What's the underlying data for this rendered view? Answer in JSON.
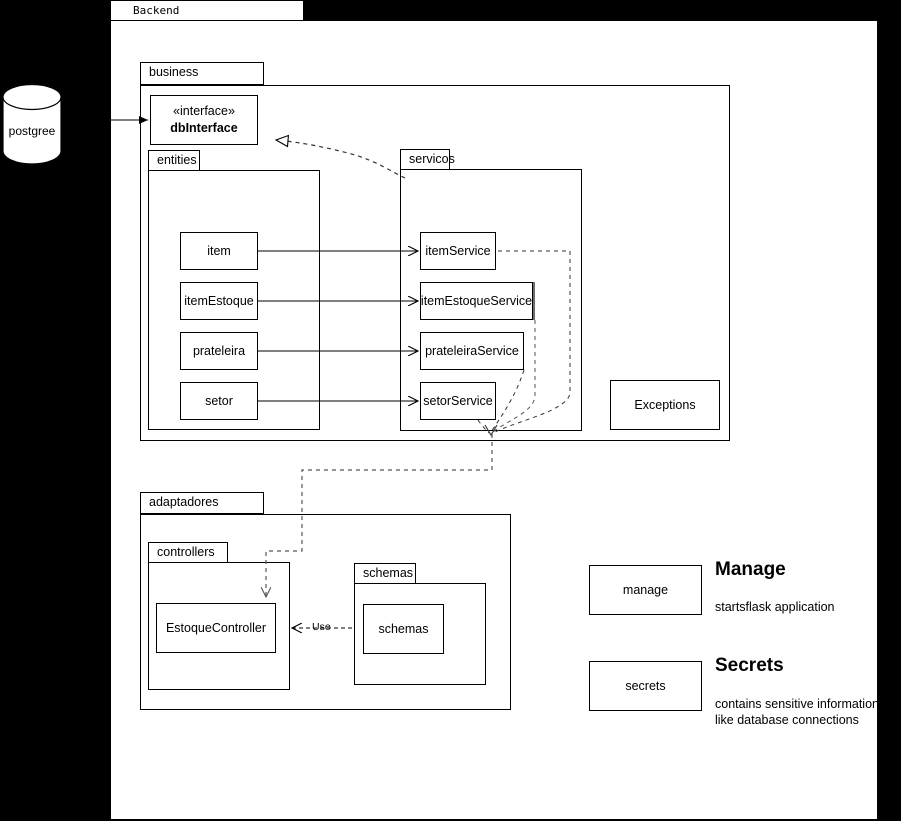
{
  "diagram": {
    "background_color": "#000000",
    "frame_color": "#ffffff",
    "line_color": "#000000",
    "shadow_color": "#6e6e6e"
  },
  "backend": {
    "tab_label": "Backend"
  },
  "database": {
    "label": "postgree",
    "icon": "database-cylinder-icon"
  },
  "business": {
    "tab_label": "business",
    "interface": {
      "stereotype": "«interface»",
      "name": "dbInterface"
    },
    "entities": {
      "tab_label": "entities",
      "items": [
        {
          "label": "item"
        },
        {
          "label": "itemEstoque"
        },
        {
          "label": "prateleira"
        },
        {
          "label": "setor"
        }
      ]
    },
    "servicos": {
      "tab_label": "servicos",
      "items": [
        {
          "label": "itemService"
        },
        {
          "label": "itemEstoqueService"
        },
        {
          "label": "prateleiraService"
        },
        {
          "label": "setorService"
        }
      ]
    },
    "exceptions": {
      "label": "Exceptions"
    }
  },
  "adaptadores": {
    "tab_label": "adaptadores",
    "controllers": {
      "tab_label": "controllers",
      "items": [
        {
          "label": "EstoqueController"
        }
      ]
    },
    "schemas": {
      "tab_label": "schemas",
      "items": [
        {
          "label": "schemas"
        }
      ]
    },
    "use_edge_label": "Use"
  },
  "legend": [
    {
      "box_label": "manage",
      "title": "Manage",
      "description_lines": [
        "startsflask application"
      ]
    },
    {
      "box_label": "secrets",
      "title": "Secrets",
      "description_lines": [
        "contains sensitive information",
        "like database connections"
      ]
    }
  ]
}
